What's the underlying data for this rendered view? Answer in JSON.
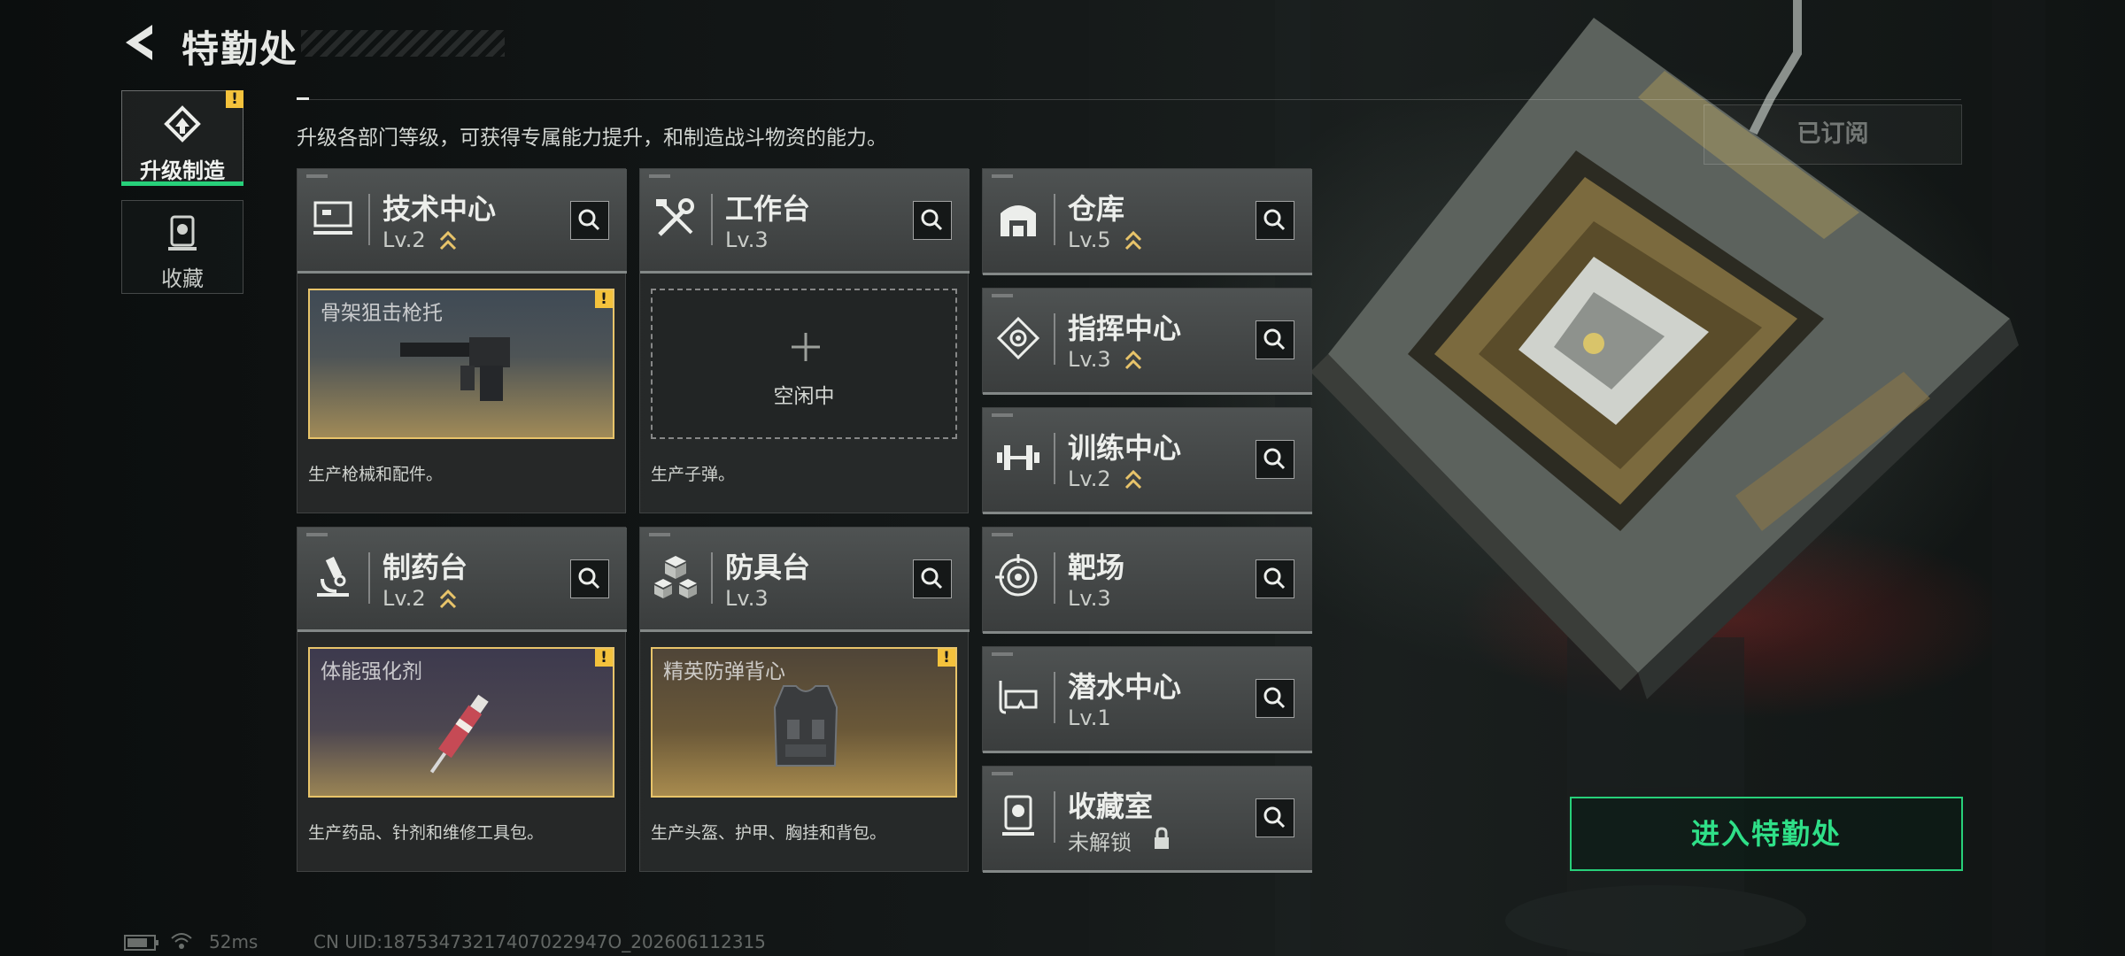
{
  "header": {
    "title": "特勤处"
  },
  "nav": {
    "tabs": [
      {
        "label": "升级制造",
        "active": true,
        "alert": "!"
      },
      {
        "label": "收藏",
        "active": false
      }
    ]
  },
  "description": "升级各部门等级，可获得专属能力提升，和制造战斗物资的能力。",
  "subscribe_button": "已订阅",
  "facilities": [
    {
      "name": "技术中心",
      "level": "Lv.2",
      "upgradable": true,
      "icon": "computer-icon",
      "slot": {
        "item": "骨架狙击枪托",
        "alert": "!"
      },
      "note": "生产枪械和配件。"
    },
    {
      "name": "工作台",
      "level": "Lv.3",
      "upgradable": false,
      "icon": "tools-icon",
      "slot": {
        "empty_label": "空闲中"
      },
      "note": "生产子弹。"
    },
    {
      "name": "仓库",
      "level": "Lv.5",
      "upgradable": true,
      "icon": "warehouse-icon"
    },
    {
      "name": "指挥中心",
      "level": "Lv.3",
      "upgradable": true,
      "icon": "command-icon"
    },
    {
      "name": "训练中心",
      "level": "Lv.2",
      "upgradable": true,
      "icon": "dumbbell-icon"
    },
    {
      "name": "制药台",
      "level": "Lv.2",
      "upgradable": true,
      "icon": "microscope-icon",
      "slot": {
        "item": "体能强化剂",
        "alert": "!"
      },
      "note": "生产药品、针剂和维修工具包。"
    },
    {
      "name": "防具台",
      "level": "Lv.3",
      "upgradable": false,
      "icon": "armor-cubes-icon",
      "slot": {
        "item": "精英防弹背心",
        "alert": "!"
      },
      "note": "生产头盔、护甲、胸挂和背包。"
    },
    {
      "name": "靶场",
      "level": "Lv.3",
      "upgradable": false,
      "icon": "target-icon"
    },
    {
      "name": "潜水中心",
      "level": "Lv.1",
      "upgradable": false,
      "icon": "diving-mask-icon"
    },
    {
      "name": "收藏室",
      "level": "未解锁",
      "upgradable": false,
      "locked": true,
      "icon": "collection-icon"
    }
  ],
  "enter_button": "进入特勤处",
  "status": {
    "ping": "52ms",
    "uid": "CN UID:18753473217407022947O_202606112315"
  },
  "colors": {
    "accent_green": "#27d07a",
    "alert_yellow": "#f4c23c",
    "upgrade_gold": "#e8c46a"
  }
}
